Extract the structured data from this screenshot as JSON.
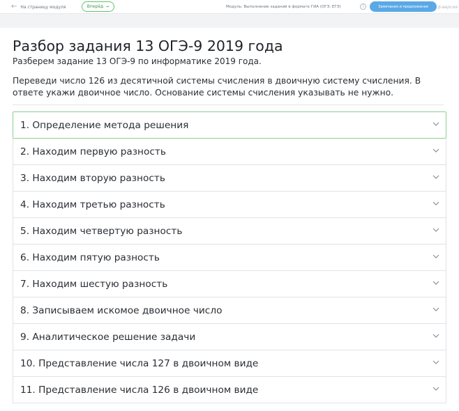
{
  "topbar": {
    "back_label": "На страницу модуля",
    "forward_label": "Вперёд",
    "forward_arrow": "→",
    "module_label": "Модуль: Выполнение заданий в формате ГИА (ОГЭ, ЕГЭ)",
    "notes_label": "Замечания и предложения",
    "beta_label": "β-версия"
  },
  "page": {
    "title": "Разбор задания 13 ОГЭ-9 2019 года",
    "subtitle": "Разберем задание 13 ОГЭ-9 по информатике 2019 года.",
    "task_text": "Переведи число 126 из десятичной системы счисления в двоичную систему счисления. В ответе укажи двоичное число. Основание системы счисления указывать не нужно."
  },
  "accordion": {
    "items": [
      {
        "label": "1. Определение метода решения",
        "active": true
      },
      {
        "label": "2. Находим первую разность"
      },
      {
        "label": "3. Находим вторую разность"
      },
      {
        "label": "4. Находим третью разность"
      },
      {
        "label": "5. Находим четвертую разность"
      },
      {
        "label": "6. Находим пятую разность"
      },
      {
        "label": "7. Находим шестую разность"
      },
      {
        "label": "8. Записываем искомое двоичное число"
      },
      {
        "label": "9. Аналитическое решение задачи"
      },
      {
        "label": "10. Представление числа 127 в двоичном виде"
      },
      {
        "label": "11. Представление числа 126 в двоичном виде"
      }
    ]
  },
  "colors": {
    "accent_green": "#5fc56d",
    "accent_blue": "#5aa9e6"
  }
}
